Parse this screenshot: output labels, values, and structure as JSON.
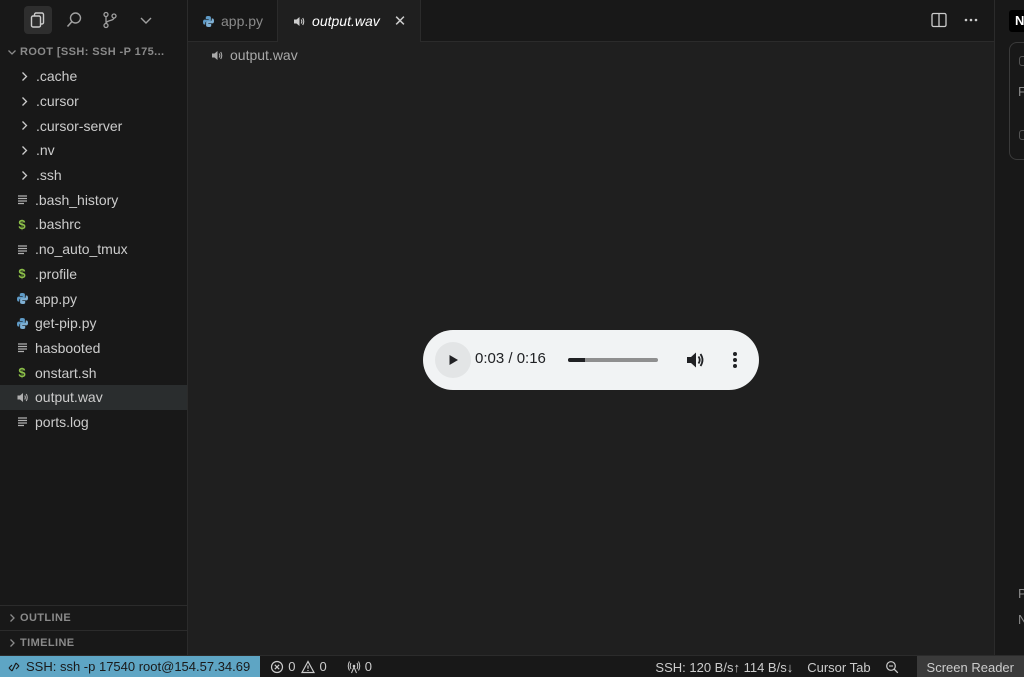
{
  "activity": {
    "items": [
      "explorer-icon",
      "search-icon",
      "source-control-icon",
      "chevron-down-icon"
    ]
  },
  "explorer": {
    "title": "ROOT [SSH: SSH -P 175...",
    "items": [
      {
        "label": ".cache",
        "kind": "folder"
      },
      {
        "label": ".cursor",
        "kind": "folder"
      },
      {
        "label": ".cursor-server",
        "kind": "folder"
      },
      {
        "label": ".nv",
        "kind": "folder"
      },
      {
        "label": ".ssh",
        "kind": "folder"
      },
      {
        "label": ".bash_history",
        "kind": "text"
      },
      {
        "label": ".bashrc",
        "kind": "shell"
      },
      {
        "label": ".no_auto_tmux",
        "kind": "text"
      },
      {
        "label": ".profile",
        "kind": "shell"
      },
      {
        "label": "app.py",
        "kind": "python"
      },
      {
        "label": "get-pip.py",
        "kind": "python"
      },
      {
        "label": "hasbooted",
        "kind": "text"
      },
      {
        "label": "onstart.sh",
        "kind": "shell"
      },
      {
        "label": "output.wav",
        "kind": "audio",
        "selected": true
      },
      {
        "label": "ports.log",
        "kind": "text"
      }
    ],
    "shell_glyph": "$",
    "outline": "OUTLINE",
    "timeline": "TIMELINE"
  },
  "tabs": [
    {
      "label": "app.py",
      "kind": "python",
      "active": false
    },
    {
      "label": "output.wav",
      "kind": "audio",
      "active": true,
      "close": "✕"
    }
  ],
  "breadcrumb": {
    "file": "output.wav"
  },
  "player": {
    "time": "0:03 / 0:16",
    "progress": 0.19,
    "colors": {
      "background": "#f1f3f4",
      "fill": "#202124"
    }
  },
  "right_panel": {
    "header": "N",
    "letters": [
      "F",
      "P",
      "N"
    ]
  },
  "statusbar": {
    "remote": "SSH: ssh -p 17540 root@154.57.34.69",
    "errors": "0",
    "warnings": "0",
    "ports": "0",
    "transfer": "SSH: 120 B/s↑ 114 B/s↓",
    "cursor_tab": "Cursor Tab",
    "screen_reader": "Screen Reader",
    "remote_color": "#5ea5c4"
  }
}
